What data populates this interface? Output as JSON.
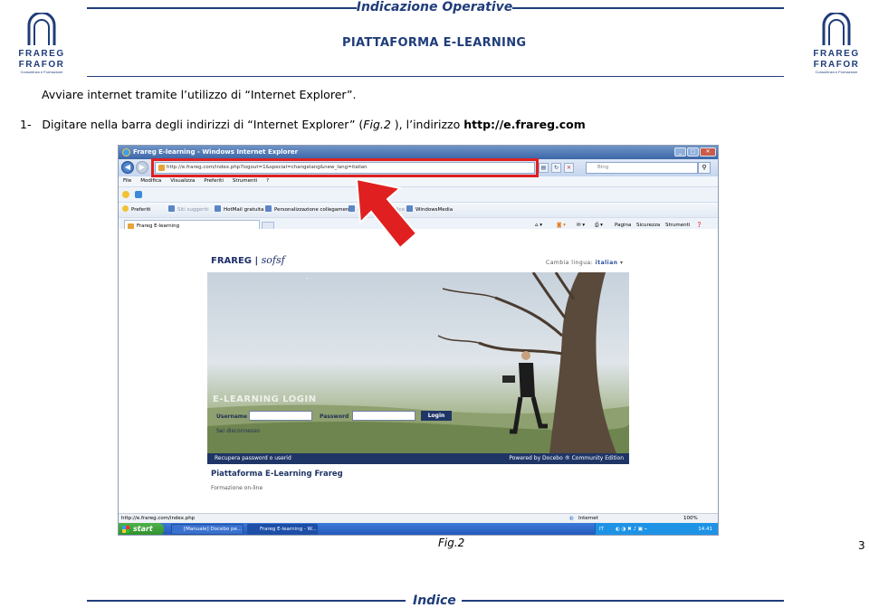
{
  "header": {
    "title": "Indicazione Operative",
    "platform": "PIATTAFORMA E-LEARNING",
    "logo_line1": "FRAREG",
    "logo_line2": "FRAFOR",
    "logo_line3": "Consulenza e Formazione"
  },
  "instructions": {
    "intro": "Avviare internet tramite l’utilizzo di “Internet Explorer”.",
    "step_number": "1-",
    "step_text_before": "Digitare nella barra degli indirizzi di “Internet Explorer” (",
    "step_fig": "Fig.2",
    "step_text_after": " ), l’indirizzo ",
    "step_url": "http://e.frareg.com"
  },
  "browser": {
    "window_title": "Frareg E-learning - Windows Internet Explorer",
    "address": "http://e.frareg.com/index.php?logout=1&special=changelang&new_lang=italian",
    "search_placeholder": "Bing",
    "menu": [
      "File",
      "Modifica",
      "Visualizza",
      "Preferiti",
      "Strumenti",
      "?"
    ],
    "favorites": {
      "label": "Preferiti",
      "items": [
        "Siti suggeriti",
        "HotMail gratuita",
        "Personalizzazione collegamenti",
        "Raccolta Web Slice",
        "WindowsMedia"
      ]
    },
    "tab_label": "Frareg E-learning",
    "toolbar": [
      "Pagina",
      "Sicurezza",
      "Strumenti"
    ],
    "status_url": "http://e.frareg.com/index.php",
    "status_zone": "Internet",
    "zoom": "100%"
  },
  "site": {
    "logo_text": "FRAREG",
    "logo_script": "sofsf",
    "lang_label": "Cambia lingua:",
    "lang_value": "italian",
    "login_title": "E-LEARNING LOGIN",
    "username_label": "Username",
    "password_label": "Password",
    "login_button": "Login",
    "status_msg": "Sei disconnesso",
    "recover_link": "Recupera password o userid",
    "powered": "Powered by Docebo ® Community Edition",
    "platform_name": "Piattaforma E-Learning Frareg",
    "platform_sub": "Formazione on-line"
  },
  "taskbar": {
    "start": "start",
    "items": [
      "[Manuale] Docebo pe...",
      "Frareg E-learning - W..."
    ],
    "lang": "IT",
    "time": "14.41"
  },
  "footer": {
    "caption": "Fig.2",
    "page_number": "3",
    "index_label": "Indice"
  },
  "colors": {
    "brand_blue": "#1f3d7a",
    "highlight_red": "#e02020"
  }
}
